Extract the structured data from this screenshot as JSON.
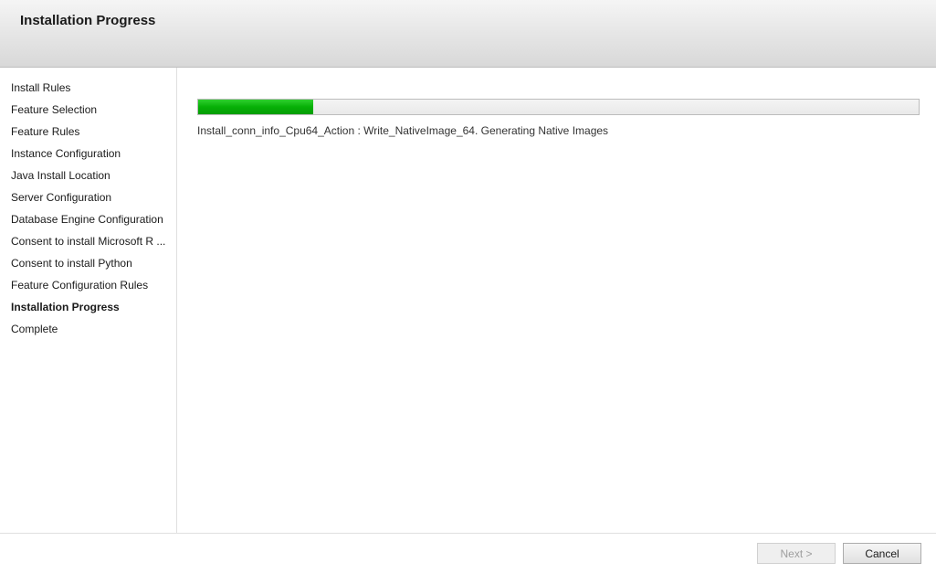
{
  "header": {
    "title": "Installation Progress"
  },
  "sidebar": {
    "items": [
      {
        "label": "Install Rules",
        "current": false
      },
      {
        "label": "Feature Selection",
        "current": false
      },
      {
        "label": "Feature Rules",
        "current": false
      },
      {
        "label": "Instance Configuration",
        "current": false
      },
      {
        "label": "Java Install Location",
        "current": false
      },
      {
        "label": "Server Configuration",
        "current": false
      },
      {
        "label": "Database Engine Configuration",
        "current": false
      },
      {
        "label": "Consent to install Microsoft R ...",
        "current": false
      },
      {
        "label": "Consent to install Python",
        "current": false
      },
      {
        "label": "Feature Configuration Rules",
        "current": false
      },
      {
        "label": "Installation Progress",
        "current": true
      },
      {
        "label": "Complete",
        "current": false
      }
    ]
  },
  "main": {
    "progress_percent": 16,
    "status_text": "Install_conn_info_Cpu64_Action : Write_NativeImage_64. Generating Native Images"
  },
  "footer": {
    "next_label": "Next >",
    "cancel_label": "Cancel",
    "next_enabled": false
  }
}
